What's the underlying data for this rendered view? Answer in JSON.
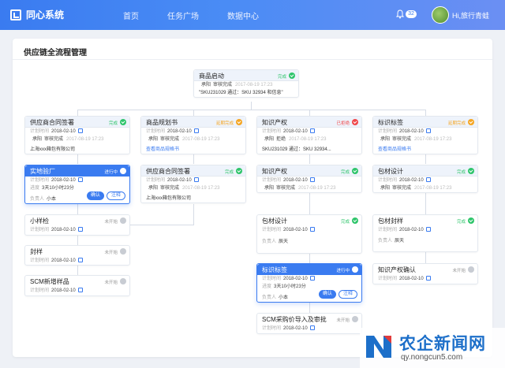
{
  "header": {
    "brand": "同心系统",
    "nav": [
      "首页",
      "任务广场",
      "数据中心"
    ],
    "notification_count": "32",
    "user_greeting": "Hi,旅行青蛙"
  },
  "page": {
    "title": "供应链全流程管理"
  },
  "labels": {
    "plan_time": "计划时间",
    "duration": "进度",
    "owner": "负责人"
  },
  "cards": {
    "root": {
      "title": "商品启动",
      "status": "完成",
      "reviewer": "承阳",
      "review": "审核完成",
      "time": "2017-08-19 17:23",
      "note": "\"SKU231029 通过：SKU 32934 和信息\""
    },
    "c1r1": {
      "title": "供应商合同签署",
      "status": "完成",
      "date": "2018-02-10",
      "reviewer": "承阳",
      "review": "审核完成",
      "time": "2017-08-19 17:23",
      "note": "上海xxx箱包有限公司"
    },
    "c1r2": {
      "title": "实地验厂",
      "status": "进行中",
      "date": "2018-02-10",
      "progress": "3天10小时23分",
      "owner": "小本",
      "ok": "确认",
      "reg": "注释"
    },
    "c1r3": {
      "title": "小样检",
      "status": "未开始",
      "date": "2018-02-10"
    },
    "c1r4": {
      "title": "封样",
      "status": "未开始",
      "date": "2018-02-10"
    },
    "c1r5": {
      "title": "SCM新增样品",
      "status": "未开始",
      "date": "2018-02-10"
    },
    "c2r1": {
      "title": "商品规划书",
      "status": "延期完成",
      "date": "2018-02-10",
      "reviewer": "承阳",
      "review": "审核完成",
      "time": "2017-08-19 17:23",
      "link": "查看商品规格书"
    },
    "c2r2": {
      "title": "供应商合同签署",
      "status": "完成",
      "date": "2018-02-10",
      "reviewer": "承阳",
      "review": "审核完成",
      "time": "2017-08-19 17:23",
      "note": "上海xxx箱包有限公司"
    },
    "c3r1": {
      "title": "知识产权",
      "status": "已拒绝",
      "date": "2018-02-10",
      "reviewer": "承阳",
      "review": "拒绝",
      "time": "2017-08-19 17:23",
      "note": "SKU231029 通过：SKU 32934..."
    },
    "c3r2": {
      "title": "知识产权",
      "status": "完成",
      "date": "2018-02-10",
      "reviewer": "承阳",
      "review": "审核完成",
      "time": "2017-08-19 17:23"
    },
    "c3r3": {
      "title": "包材设计",
      "status": "完成",
      "date": "2018-02-10",
      "owner": "辰天"
    },
    "c3r4": {
      "title": "标识标签",
      "status": "进行中",
      "date": "2018-02-10",
      "progress": "3天10小时23分",
      "owner": "小本",
      "ok": "确认",
      "reg": "注释"
    },
    "c3r5": {
      "title": "SCM采购价导入及审批",
      "status": "未开始",
      "date": "2018-02-10"
    },
    "c4r1": {
      "title": "标识标签",
      "status": "延期完成",
      "date": "2018-02-10",
      "reviewer": "承阳",
      "review": "审核完成",
      "time": "2017-08-19 17:23",
      "link": "查看商品规格书"
    },
    "c4r2": {
      "title": "包材设计",
      "status": "完成",
      "date": "2018-02-10",
      "reviewer": "承阳",
      "review": "审核完成",
      "time": "2017-08-19 17:23"
    },
    "c4r3": {
      "title": "包材封样",
      "status": "完成",
      "date": "2018-02-10",
      "owner": "辰天"
    },
    "c4r4": {
      "title": "知识产权确认",
      "status": "未开始",
      "date": "2018-02-10"
    }
  },
  "watermark": {
    "cn": "农企新闻网",
    "en": "qy.nongcun5.com"
  },
  "colors": {
    "primary": "#3a7bf0",
    "done": "#2fc56b",
    "delayed": "#f5a623",
    "rejected": "#f0484a",
    "pending": "#999999"
  }
}
